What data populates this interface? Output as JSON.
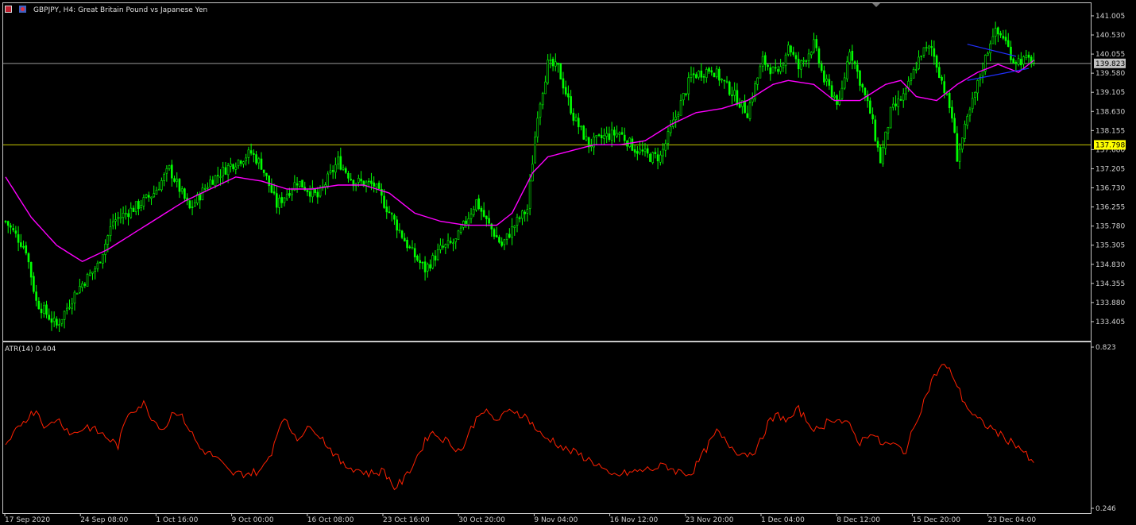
{
  "header": {
    "symbol_text": "GBPJPY, H4:  Great Britain Pound vs Japanese Yen",
    "indicator_text": "ATR(14) 0.404"
  },
  "colors": {
    "background": "#000000",
    "candles": "#00ff00",
    "ma": "#ff00ff",
    "atr": "#ff2000",
    "price_line": "#9a9a9a",
    "hline": "#c8c800",
    "trend": "#2030ff",
    "hline_label_bg": "#ffff00",
    "price_label_bg": "#c0c0c0"
  },
  "chart_data": [
    {
      "type": "candlestick",
      "title": "GBPJPY, H4:  Great Britain Pound vs Japanese Yen",
      "ylim": [
        132.93,
        141.32
      ],
      "y_ticks": [
        "141.005",
        "140.530",
        "140.055",
        "139.580",
        "139.105",
        "138.630",
        "138.155",
        "137.680",
        "137.205",
        "136.730",
        "136.255",
        "135.780",
        "135.305",
        "134.830",
        "134.355",
        "133.880",
        "133.405"
      ],
      "current_price": "139.823",
      "current_price_value": 139.823,
      "hline_label": "137.798",
      "hline_value": 137.798,
      "x_ticks": [
        "17 Sep 2020",
        "24 Sep 08:00",
        "1 Oct 16:00",
        "9 Oct 00:00",
        "16 Oct 08:00",
        "23 Oct 16:00",
        "30 Oct 20:00",
        "9 Nov 04:00",
        "16 Nov 12:00",
        "23 Nov 20:00",
        "1 Dec 04:00",
        "8 Dec 12:00",
        "15 Dec 20:00",
        "23 Dec 04:00"
      ],
      "anchors": [
        [
          0,
          135.9
        ],
        [
          8,
          135.2
        ],
        [
          12,
          133.9
        ],
        [
          20,
          133.3
        ],
        [
          28,
          134.2
        ],
        [
          36,
          134.8
        ],
        [
          42,
          135.9
        ],
        [
          52,
          136.3
        ],
        [
          58,
          136.6
        ],
        [
          64,
          137.2
        ],
        [
          72,
          136.2
        ],
        [
          80,
          136.9
        ],
        [
          88,
          137.3
        ],
        [
          96,
          137.6
        ],
        [
          100,
          137.3
        ],
        [
          106,
          136.3
        ],
        [
          114,
          136.9
        ],
        [
          122,
          136.5
        ],
        [
          130,
          137.4
        ],
        [
          136,
          136.9
        ],
        [
          144,
          136.8
        ],
        [
          152,
          135.9
        ],
        [
          158,
          135.2
        ],
        [
          164,
          134.7
        ],
        [
          170,
          135.2
        ],
        [
          176,
          135.4
        ],
        [
          184,
          136.4
        ],
        [
          188,
          135.9
        ],
        [
          194,
          135.3
        ],
        [
          200,
          135.9
        ],
        [
          204,
          136.2
        ],
        [
          208,
          138.6
        ],
        [
          212,
          139.8
        ],
        [
          216,
          139.7
        ],
        [
          222,
          138.5
        ],
        [
          228,
          137.8
        ],
        [
          234,
          138.0
        ],
        [
          240,
          138.1
        ],
        [
          246,
          137.7
        ],
        [
          252,
          137.5
        ],
        [
          256,
          137.5
        ],
        [
          262,
          138.5
        ],
        [
          268,
          139.5
        ],
        [
          276,
          139.7
        ],
        [
          284,
          139.1
        ],
        [
          290,
          138.6
        ],
        [
          296,
          139.9
        ],
        [
          302,
          139.5
        ],
        [
          306,
          140.3
        ],
        [
          310,
          139.7
        ],
        [
          316,
          140.3
        ],
        [
          320,
          139.4
        ],
        [
          326,
          138.8
        ],
        [
          330,
          140.2
        ],
        [
          334,
          139.4
        ],
        [
          338,
          138.6
        ],
        [
          342,
          137.4
        ],
        [
          346,
          138.6
        ],
        [
          352,
          139.1
        ],
        [
          358,
          140.1
        ],
        [
          362,
          140.2
        ],
        [
          366,
          139.4
        ],
        [
          370,
          138.5
        ],
        [
          372,
          137.5
        ],
        [
          376,
          138.4
        ],
        [
          380,
          139.3
        ],
        [
          386,
          140.6
        ],
        [
          390,
          140.5
        ],
        [
          394,
          139.9
        ],
        [
          398,
          139.9
        ],
        [
          402,
          139.9
        ]
      ],
      "ma_anchors": [
        [
          0,
          137.0
        ],
        [
          10,
          136.0
        ],
        [
          20,
          135.3
        ],
        [
          30,
          134.9
        ],
        [
          40,
          135.2
        ],
        [
          50,
          135.6
        ],
        [
          60,
          136.0
        ],
        [
          70,
          136.4
        ],
        [
          80,
          136.7
        ],
        [
          90,
          137.0
        ],
        [
          100,
          136.9
        ],
        [
          110,
          136.7
        ],
        [
          120,
          136.7
        ],
        [
          130,
          136.8
        ],
        [
          140,
          136.8
        ],
        [
          150,
          136.6
        ],
        [
          160,
          136.1
        ],
        [
          170,
          135.9
        ],
        [
          180,
          135.8
        ],
        [
          192,
          135.8
        ],
        [
          198,
          136.1
        ],
        [
          206,
          137.1
        ],
        [
          212,
          137.5
        ],
        [
          218,
          137.6
        ],
        [
          230,
          137.8
        ],
        [
          240,
          137.8
        ],
        [
          250,
          137.9
        ],
        [
          260,
          138.3
        ],
        [
          270,
          138.6
        ],
        [
          280,
          138.7
        ],
        [
          290,
          138.9
        ],
        [
          300,
          139.3
        ],
        [
          306,
          139.4
        ],
        [
          316,
          139.3
        ],
        [
          324,
          138.9
        ],
        [
          334,
          138.9
        ],
        [
          344,
          139.3
        ],
        [
          350,
          139.4
        ],
        [
          356,
          139.0
        ],
        [
          364,
          138.9
        ],
        [
          372,
          139.3
        ],
        [
          380,
          139.6
        ],
        [
          388,
          139.8
        ],
        [
          396,
          139.6
        ],
        [
          402,
          139.9
        ]
      ],
      "trend_lines": [
        {
          "from": [
            376,
            140.3
          ],
          "to": [
            395,
            140.0
          ]
        },
        {
          "from": [
            376,
            139.4
          ],
          "to": [
            400,
            139.7
          ]
        }
      ]
    },
    {
      "type": "line",
      "title": "ATR(14) 0.404",
      "ylim": [
        0.246,
        0.823
      ],
      "y_ticks": [
        "0.823",
        "0.246"
      ],
      "values_anchors": [
        [
          0,
          0.46
        ],
        [
          6,
          0.55
        ],
        [
          12,
          0.6
        ],
        [
          16,
          0.53
        ],
        [
          20,
          0.57
        ],
        [
          26,
          0.51
        ],
        [
          32,
          0.54
        ],
        [
          38,
          0.51
        ],
        [
          44,
          0.47
        ],
        [
          48,
          0.59
        ],
        [
          54,
          0.62
        ],
        [
          58,
          0.56
        ],
        [
          62,
          0.53
        ],
        [
          66,
          0.6
        ],
        [
          70,
          0.56
        ],
        [
          76,
          0.46
        ],
        [
          82,
          0.43
        ],
        [
          88,
          0.37
        ],
        [
          94,
          0.37
        ],
        [
          100,
          0.38
        ],
        [
          104,
          0.45
        ],
        [
          108,
          0.57
        ],
        [
          114,
          0.5
        ],
        [
          120,
          0.54
        ],
        [
          126,
          0.47
        ],
        [
          132,
          0.4
        ],
        [
          136,
          0.39
        ],
        [
          142,
          0.37
        ],
        [
          148,
          0.38
        ],
        [
          152,
          0.32
        ],
        [
          156,
          0.35
        ],
        [
          162,
          0.45
        ],
        [
          166,
          0.52
        ],
        [
          172,
          0.49
        ],
        [
          178,
          0.45
        ],
        [
          182,
          0.53
        ],
        [
          186,
          0.6
        ],
        [
          192,
          0.56
        ],
        [
          198,
          0.6
        ],
        [
          204,
          0.57
        ],
        [
          210,
          0.5
        ],
        [
          214,
          0.49
        ],
        [
          218,
          0.46
        ],
        [
          224,
          0.44
        ],
        [
          232,
          0.4
        ],
        [
          236,
          0.36
        ],
        [
          242,
          0.37
        ],
        [
          248,
          0.38
        ],
        [
          254,
          0.39
        ],
        [
          258,
          0.4
        ],
        [
          262,
          0.38
        ],
        [
          268,
          0.37
        ],
        [
          274,
          0.46
        ],
        [
          278,
          0.52
        ],
        [
          282,
          0.48
        ],
        [
          286,
          0.45
        ],
        [
          290,
          0.44
        ],
        [
          294,
          0.46
        ],
        [
          298,
          0.55
        ],
        [
          302,
          0.58
        ],
        [
          306,
          0.56
        ],
        [
          310,
          0.6
        ],
        [
          314,
          0.55
        ],
        [
          318,
          0.52
        ],
        [
          322,
          0.57
        ],
        [
          326,
          0.56
        ],
        [
          330,
          0.54
        ],
        [
          334,
          0.48
        ],
        [
          338,
          0.52
        ],
        [
          342,
          0.48
        ],
        [
          348,
          0.47
        ],
        [
          352,
          0.45
        ],
        [
          356,
          0.56
        ],
        [
          362,
          0.7
        ],
        [
          366,
          0.76
        ],
        [
          370,
          0.73
        ],
        [
          374,
          0.64
        ],
        [
          378,
          0.58
        ],
        [
          382,
          0.55
        ],
        [
          386,
          0.53
        ],
        [
          390,
          0.5
        ],
        [
          396,
          0.47
        ],
        [
          402,
          0.4
        ]
      ]
    }
  ]
}
